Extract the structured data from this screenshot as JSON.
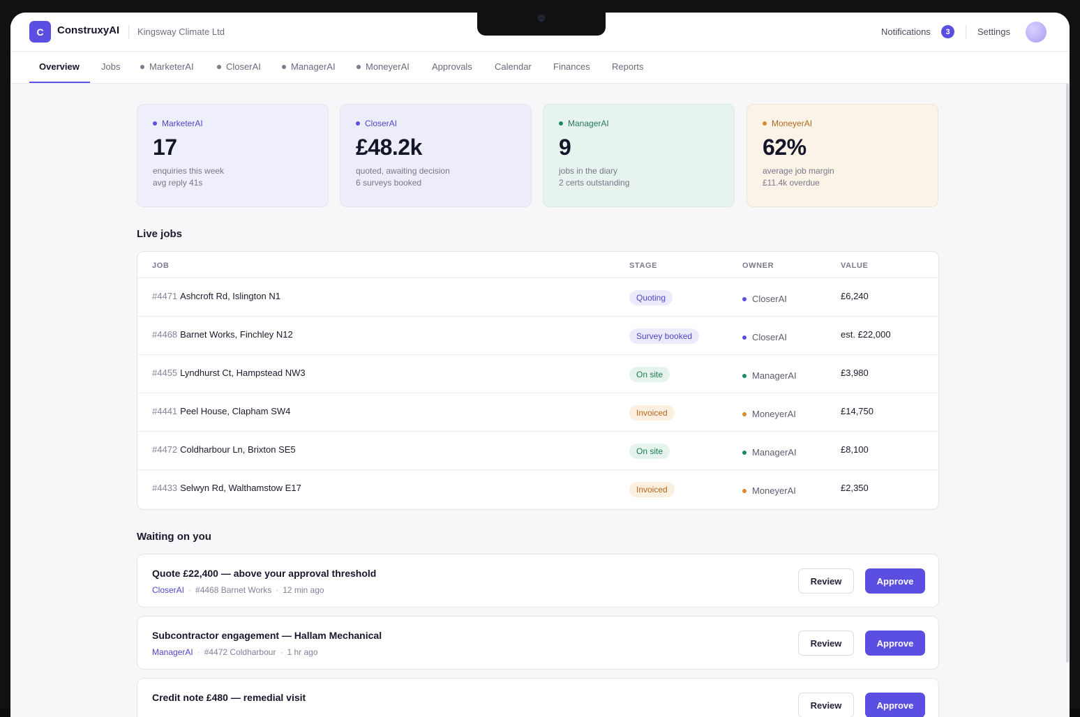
{
  "header": {
    "logo_letter": "C",
    "app_name": "ConstruxyAI",
    "company": "Kingsway Climate Ltd",
    "notifications_label": "Notifications",
    "notifications_count": "3",
    "settings_label": "Settings"
  },
  "tabs": [
    {
      "label": "Overview"
    },
    {
      "label": "Jobs"
    },
    {
      "label": "MarketerAI"
    },
    {
      "label": "CloserAI"
    },
    {
      "label": "ManagerAI"
    },
    {
      "label": "MoneyerAI"
    },
    {
      "label": "Approvals"
    },
    {
      "label": "Calendar"
    },
    {
      "label": "Finances"
    },
    {
      "label": "Reports"
    }
  ],
  "cards": [
    {
      "agent": "MarketerAI",
      "value": "17",
      "line1": "enquiries this week",
      "line2": "avg reply 41s"
    },
    {
      "agent": "CloserAI",
      "value": "£48.2k",
      "line1": "quoted, awaiting decision",
      "line2": "6 surveys booked"
    },
    {
      "agent": "ManagerAI",
      "value": "9",
      "line1": "jobs in the diary",
      "line2": "2 certs outstanding"
    },
    {
      "agent": "MoneyerAI",
      "value": "62%",
      "line1": "average job margin",
      "line2": "£11.4k overdue"
    }
  ],
  "live_jobs": {
    "title": "Live jobs",
    "columns": [
      "JOB",
      "STAGE",
      "OWNER",
      "VALUE"
    ],
    "rows": [
      {
        "id": "#4471",
        "name": "Ashcroft Rd, Islington N1",
        "stage": "Quoting",
        "owner": "CloserAI",
        "value": "£6,240"
      },
      {
        "id": "#4468",
        "name": "Barnet Works, Finchley N12",
        "stage": "Survey booked",
        "owner": "CloserAI",
        "value": "est. £22,000"
      },
      {
        "id": "#4455",
        "name": "Lyndhurst Ct, Hampstead NW3",
        "stage": "On site",
        "owner": "ManagerAI",
        "value": "£3,980"
      },
      {
        "id": "#4441",
        "name": "Peel House, Clapham SW4",
        "stage": "Invoiced",
        "owner": "MoneyerAI",
        "value": "£14,750"
      },
      {
        "id": "#4472",
        "name": "Coldharbour Ln, Brixton SE5",
        "stage": "On site",
        "owner": "ManagerAI",
        "value": "£8,100"
      },
      {
        "id": "#4433",
        "name": "Selwyn Rd, Walthamstow E17",
        "stage": "Invoiced",
        "owner": "MoneyerAI",
        "value": "£2,350"
      }
    ]
  },
  "waiting": {
    "title": "Waiting on you",
    "review_label": "Review",
    "approve_label": "Approve",
    "items": [
      {
        "title": "Quote £22,400 — above your approval threshold",
        "agent": "CloserAI",
        "ref": "#4468 Barnet Works",
        "time": "12 min ago"
      },
      {
        "title": "Subcontractor engagement — Hallam Mechanical",
        "agent": "ManagerAI",
        "ref": "#4472 Coldharbour",
        "time": "1 hr ago"
      },
      {
        "title": "Credit note £480 — remedial visit"
      }
    ]
  },
  "colors": {
    "accent": "#5a4fe0",
    "manager": "#1f8a62",
    "moneyer": "#d98a2b"
  }
}
